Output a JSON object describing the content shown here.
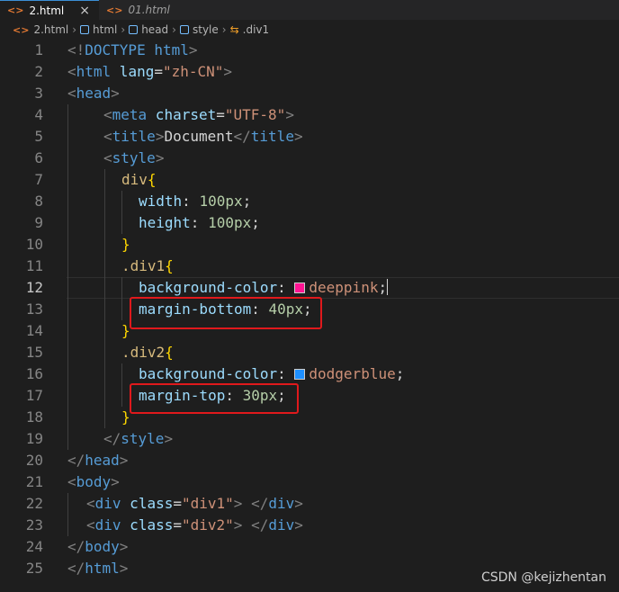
{
  "tabs": [
    {
      "icon": "html-file-icon",
      "label": "2.html",
      "active": true,
      "close": "×"
    },
    {
      "icon": "html-file-icon",
      "label": "01.html",
      "active": false
    }
  ],
  "breadcrumb": [
    "2.html",
    "html",
    "head",
    "style",
    ".div1"
  ],
  "icons": {
    "html": "<>",
    "class": "⇆"
  },
  "lines": [
    {
      "n": "1",
      "text": "<!DOCTYPE html>"
    },
    {
      "n": "2",
      "text": "<html lang=\"zh-CN\">"
    },
    {
      "n": "3",
      "text": "<head>"
    },
    {
      "n": "4",
      "text": "<meta charset=\"UTF-8\">"
    },
    {
      "n": "5",
      "text": "<title>Document</title>"
    },
    {
      "n": "6",
      "text": "<style>"
    },
    {
      "n": "7",
      "text": "div{"
    },
    {
      "n": "8",
      "text": "width: 100px;"
    },
    {
      "n": "9",
      "text": "height: 100px;"
    },
    {
      "n": "10",
      "text": "}"
    },
    {
      "n": "11",
      "text": ".div1{"
    },
    {
      "n": "12",
      "text": "background-color: deeppink;"
    },
    {
      "n": "13",
      "text": "margin-bottom: 40px;"
    },
    {
      "n": "14",
      "text": "}"
    },
    {
      "n": "15",
      "text": ".div2{"
    },
    {
      "n": "16",
      "text": "background-color: dodgerblue;"
    },
    {
      "n": "17",
      "text": "margin-top: 30px;"
    },
    {
      "n": "18",
      "text": "}"
    },
    {
      "n": "19",
      "text": "</style>"
    },
    {
      "n": "20",
      "text": "</head>"
    },
    {
      "n": "21",
      "text": "<body>"
    },
    {
      "n": "22",
      "text": "<div class=\"div1\"> </div>"
    },
    {
      "n": "23",
      "text": "<div class=\"div2\"> </div>"
    },
    {
      "n": "24",
      "text": "</body>"
    },
    {
      "n": "25",
      "text": "</html>"
    }
  ],
  "swatches": {
    "deeppink": "#ff1493",
    "dodgerblue": "#1e90ff"
  },
  "current_line": "12",
  "watermark": "CSDN @kejizhentan"
}
